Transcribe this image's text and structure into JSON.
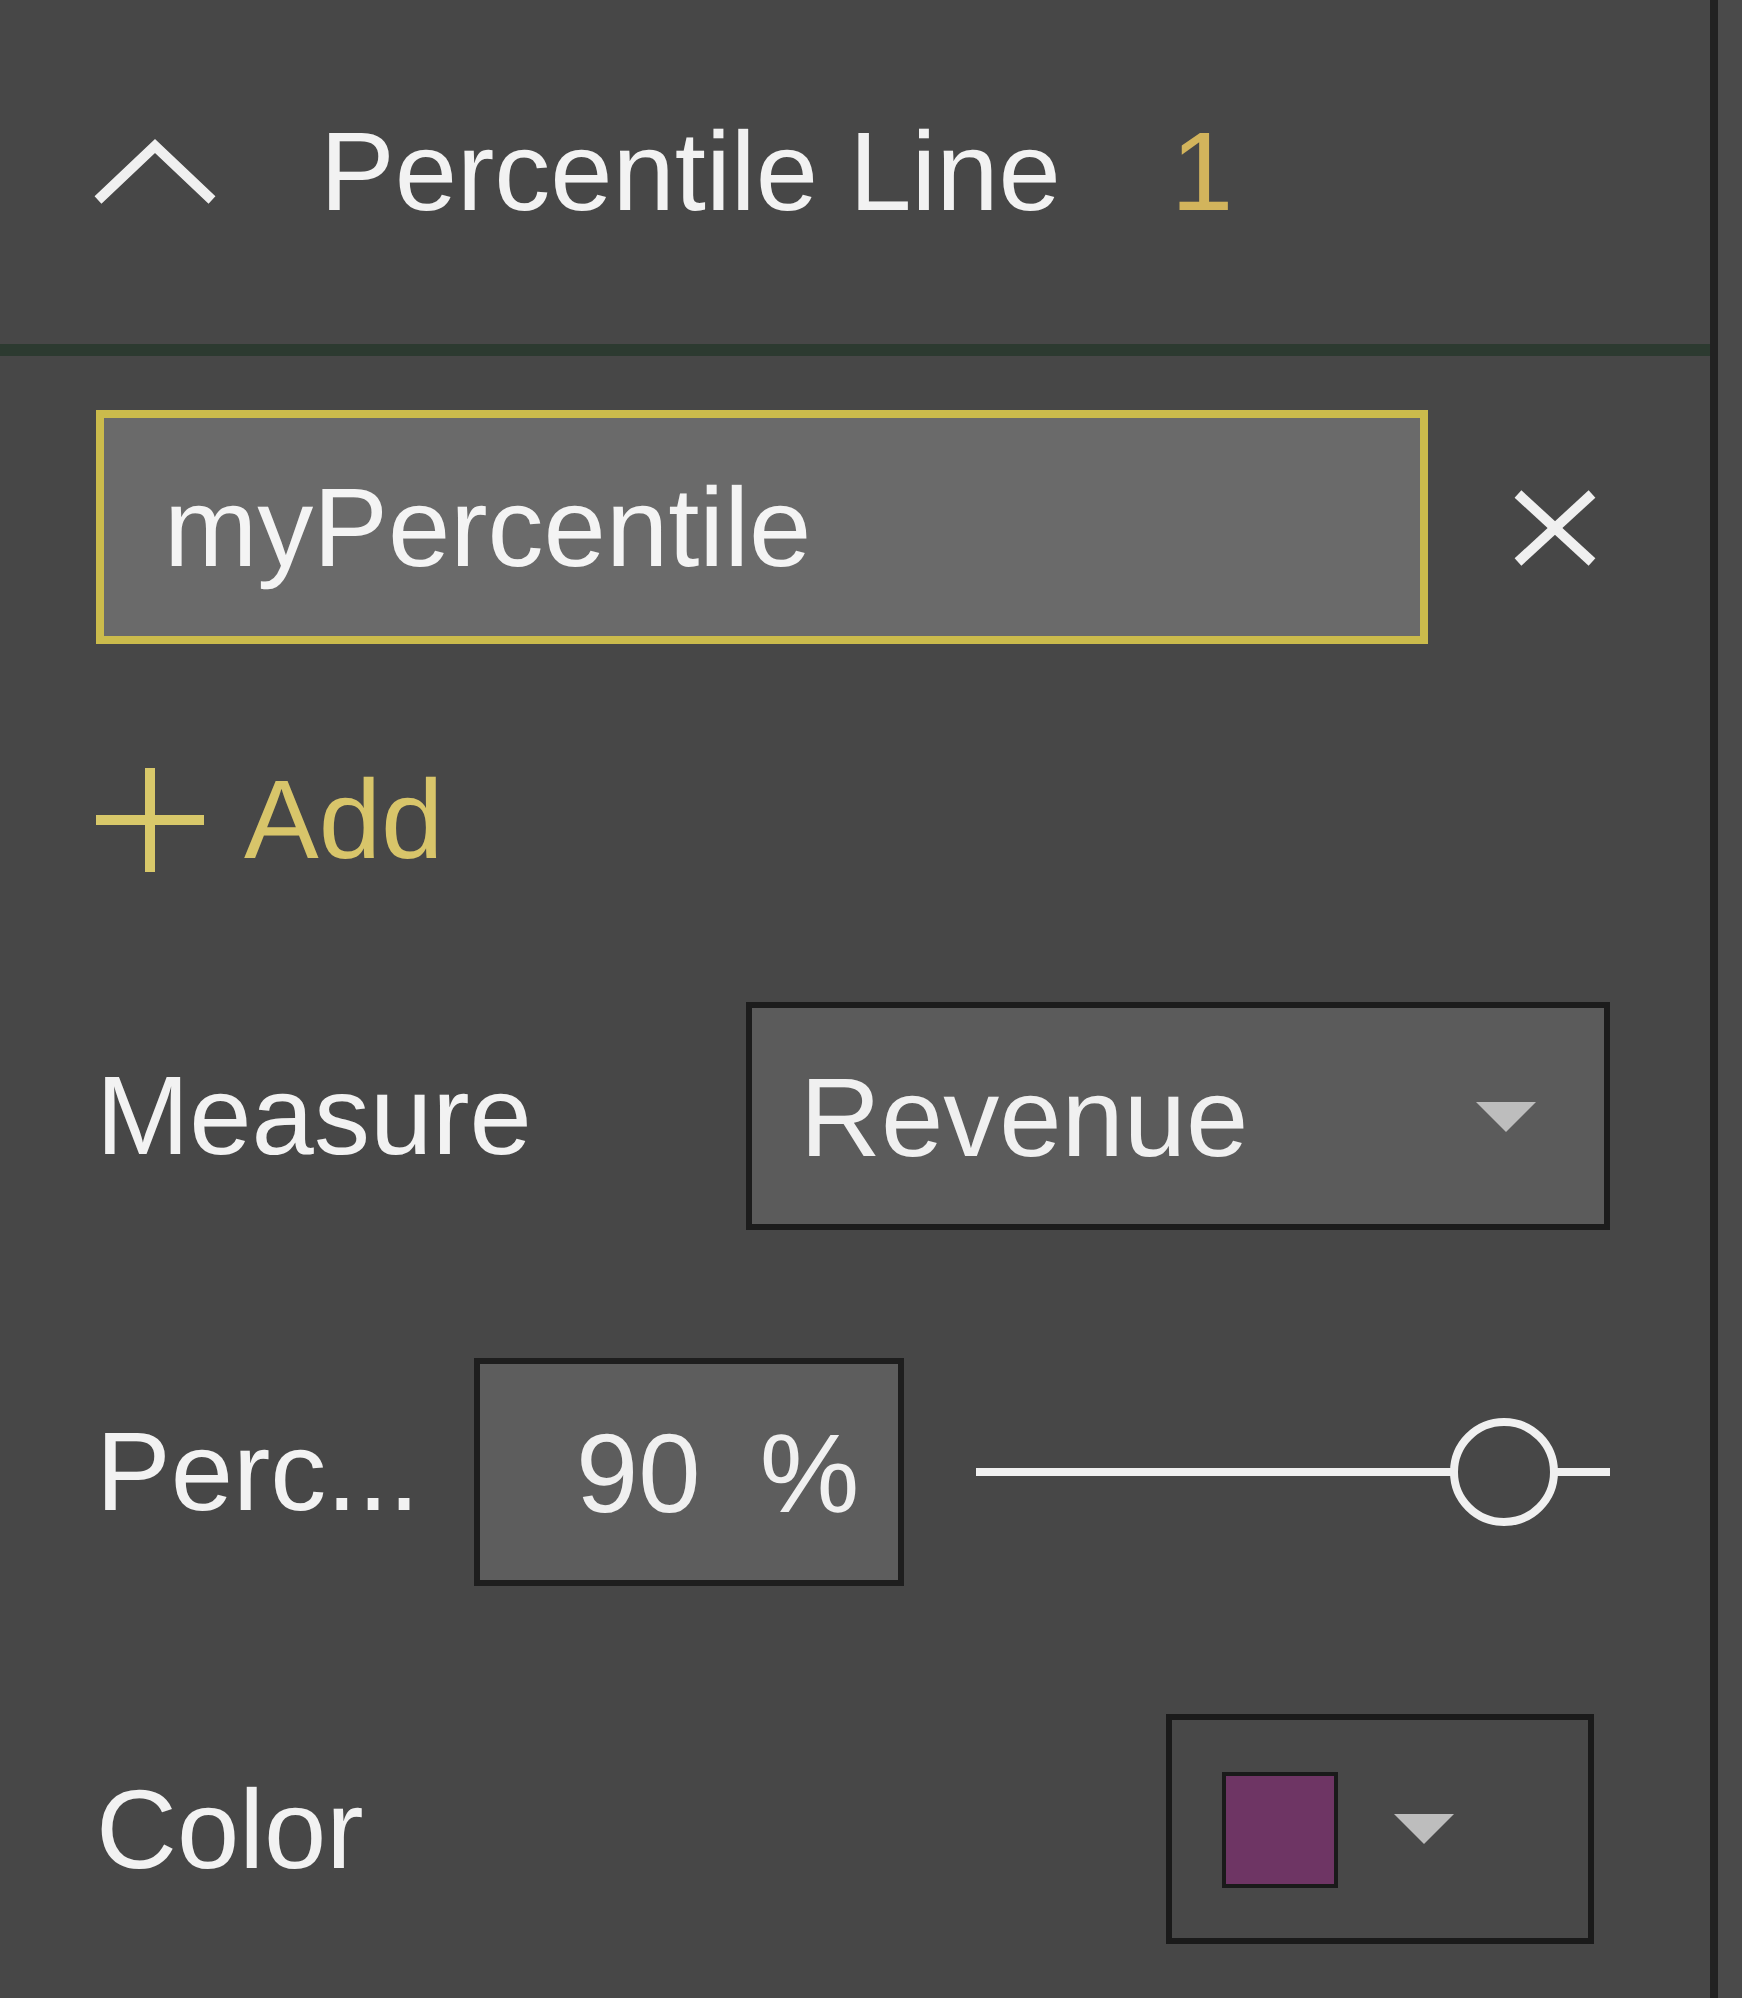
{
  "section": {
    "title": "Percentile Line",
    "count": "1",
    "expanded": true
  },
  "lines": [
    {
      "name": "myPercentile",
      "selected": true
    }
  ],
  "add_button": {
    "label": "Add"
  },
  "fields": [
    {
      "kind": "dropdown",
      "label": "Measure",
      "value": "Revenue"
    },
    {
      "kind": "percent",
      "label": "Perc...",
      "value": "90",
      "unit": "%",
      "level": 0.9
    },
    {
      "kind": "color",
      "label": "Color",
      "color": "#6e3564"
    }
  ]
}
